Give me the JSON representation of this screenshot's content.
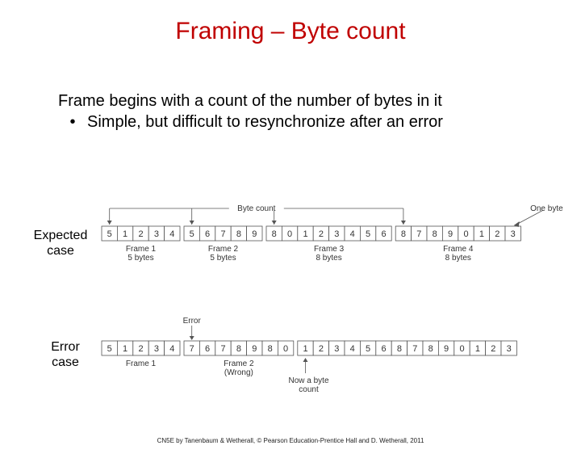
{
  "title": "Framing – Byte count",
  "intro_line": "Frame begins with a count of the number of bytes in it",
  "bullet_marker": "•",
  "bullet_text": "Simple, but difficult to resynchronize after an error",
  "labels": {
    "expected": "Expected case",
    "error": "Error case",
    "byte_count": "Byte count",
    "one_byte": "One byte",
    "error_top": "Error",
    "now_a_byte": "Now a byte count"
  },
  "chart_data": [
    {
      "type": "table",
      "title": "Expected case",
      "cells": [
        "5",
        "1",
        "2",
        "3",
        "4",
        "5",
        "6",
        "7",
        "8",
        "9",
        "8",
        "0",
        "1",
        "2",
        "3",
        "4",
        "5",
        "6",
        "8",
        "7",
        "8",
        "9",
        "0",
        "1",
        "2",
        "3"
      ],
      "frame_starts": [
        0,
        5,
        10,
        18
      ],
      "pointer_cells": [
        0,
        5,
        10,
        18
      ],
      "pointer_label": "Byte count",
      "right_label": "One byte",
      "frame_captions": [
        {
          "line1": "Frame 1",
          "line2": "5 bytes"
        },
        {
          "line1": "Frame 2",
          "line2": "5 bytes"
        },
        {
          "line1": "Frame 3",
          "line2": "8 bytes"
        },
        {
          "line1": "Frame 4",
          "line2": "8 bytes"
        }
      ]
    },
    {
      "type": "table",
      "title": "Error case",
      "cells": [
        "5",
        "1",
        "2",
        "3",
        "4",
        "7",
        "6",
        "7",
        "8",
        "9",
        "8",
        "0",
        "1",
        "2",
        "3",
        "4",
        "5",
        "6",
        "8",
        "7",
        "8",
        "9",
        "0",
        "1",
        "2",
        "3"
      ],
      "frame_starts": [
        0,
        5,
        12
      ],
      "pointer_cells": [
        5
      ],
      "pointer_label": "Error",
      "now_pointer_cell": 12,
      "now_label": "Now a byte count",
      "frame_captions": [
        {
          "line1": "Frame 1",
          "line2": ""
        },
        {
          "line1": "Frame 2",
          "line2": "(Wrong)"
        }
      ]
    }
  ],
  "footer": "CN5E by Tanenbaum & Wetherall, © Pearson Education-Prentice Hall and D. Wetherall, 2011"
}
